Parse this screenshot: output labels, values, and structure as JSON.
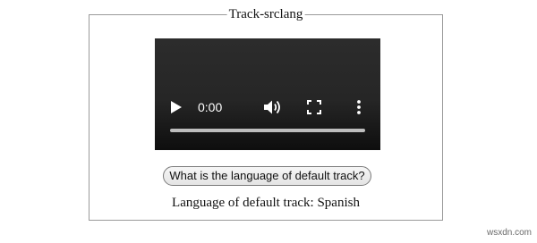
{
  "fieldset": {
    "legend": "Track-srclang"
  },
  "video": {
    "current_time": "0:00",
    "progress": 0,
    "icons": {
      "play": "play-icon",
      "volume": "volume-icon",
      "fullscreen": "fullscreen-icon",
      "menu": "more-options-icon"
    }
  },
  "query_button": {
    "label": "What is the language of default track?"
  },
  "result": {
    "text": "Language of default track: Spanish"
  },
  "watermark": {
    "text": "wsxdn.com"
  },
  "colors": {
    "video_background": "#262626",
    "control_icons": "#ffffff",
    "progress_track": "#bdbdbd",
    "fieldset_border": "#9a9a9a"
  }
}
